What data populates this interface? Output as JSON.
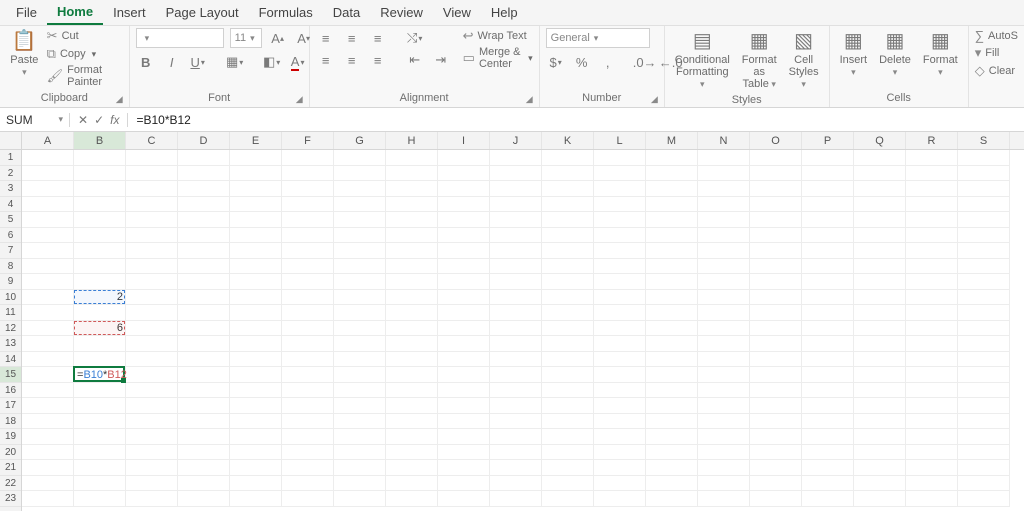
{
  "tabs": [
    "File",
    "Home",
    "Insert",
    "Page Layout",
    "Formulas",
    "Data",
    "Review",
    "View",
    "Help"
  ],
  "activeTab": 1,
  "ribbon": {
    "clipboard": {
      "paste": "Paste",
      "cut": "Cut",
      "copy": "Copy",
      "formatPainter": "Format Painter",
      "label": "Clipboard"
    },
    "font": {
      "fontName": "",
      "fontSize": "11",
      "label": "Font"
    },
    "alignment": {
      "wrap": "Wrap Text",
      "merge": "Merge & Center",
      "label": "Alignment"
    },
    "number": {
      "format": "General",
      "label": "Number"
    },
    "styles": {
      "cond": "Conditional Formatting",
      "table": "Format as Table",
      "cell": "Cell Styles",
      "label": "Styles"
    },
    "cells": {
      "insert": "Insert",
      "delete": "Delete",
      "format": "Format",
      "label": "Cells"
    },
    "editing": {
      "autosum": "AutoS",
      "fill": "Fill",
      "clear": "Clear"
    }
  },
  "formulaBar": {
    "nameBox": "SUM",
    "formula": "=B10*B12"
  },
  "grid": {
    "columns": [
      "A",
      "B",
      "C",
      "D",
      "E",
      "F",
      "G",
      "H",
      "I",
      "J",
      "K",
      "L",
      "M",
      "N",
      "O",
      "P",
      "Q",
      "R",
      "S"
    ],
    "activeCol": "B",
    "rows": 23,
    "activeRow": 15,
    "cells": {
      "B10": "2",
      "B12": "6",
      "B15": "=B10*B12"
    },
    "editCell": {
      "row": 15,
      "col": 1,
      "parts": [
        {
          "text": "=",
          "cls": ""
        },
        {
          "text": "B10",
          "cls": "t-blue"
        },
        {
          "text": "*",
          "cls": ""
        },
        {
          "text": "B12",
          "cls": "t-red"
        }
      ]
    },
    "refBoxes": [
      {
        "row": 10,
        "col": 1,
        "cls": "blue"
      },
      {
        "row": 12,
        "col": 1,
        "cls": "red"
      }
    ]
  }
}
